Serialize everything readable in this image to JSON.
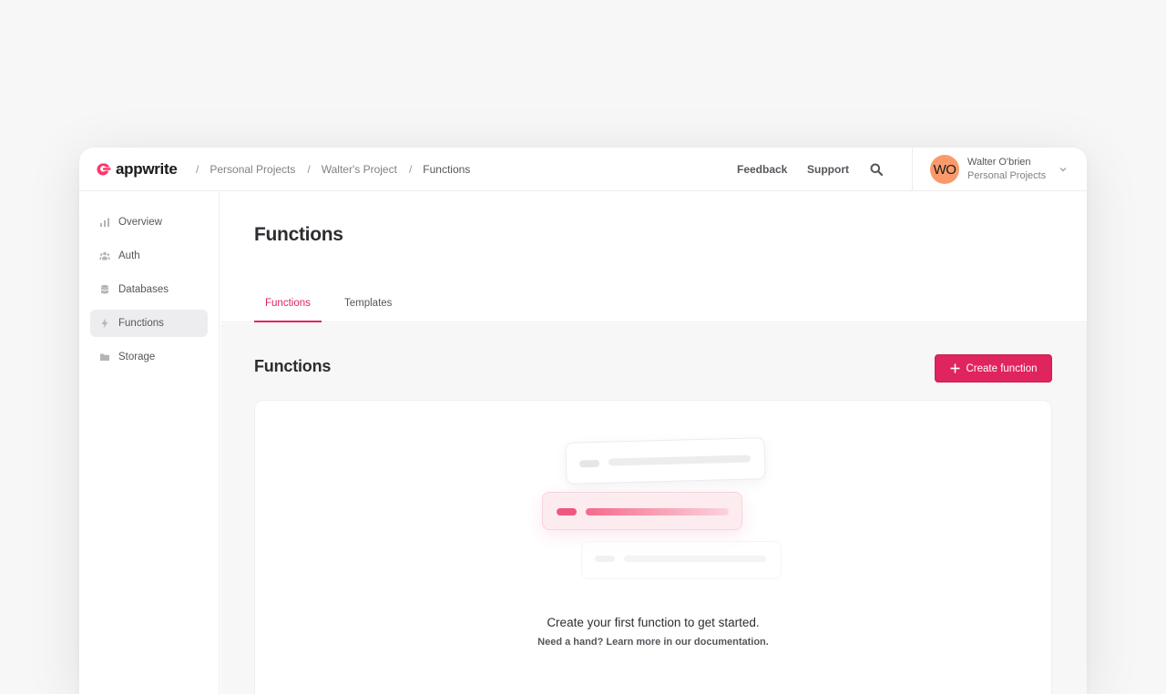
{
  "brand": {
    "name": "appwrite",
    "accent": "#e0245e"
  },
  "breadcrumb": [
    "Personal Projects",
    "Walter's Project",
    "Functions"
  ],
  "header": {
    "feedback": "Feedback",
    "support": "Support",
    "search_icon": "search-icon",
    "user": {
      "initials": "WO",
      "name": "Walter O'brien",
      "org": "Personal Projects"
    }
  },
  "sidebar": {
    "items": [
      {
        "label": "Overview",
        "icon": "bar-chart-icon",
        "active": false
      },
      {
        "label": "Auth",
        "icon": "users-icon",
        "active": false
      },
      {
        "label": "Databases",
        "icon": "database-icon",
        "active": false
      },
      {
        "label": "Functions",
        "icon": "lightning-icon",
        "active": true
      },
      {
        "label": "Storage",
        "icon": "folder-icon",
        "active": false
      }
    ]
  },
  "main": {
    "title": "Functions",
    "tabs": [
      {
        "label": "Functions",
        "active": true
      },
      {
        "label": "Templates",
        "active": false
      }
    ],
    "section_title": "Functions",
    "create_button": "Create function",
    "empty_state": {
      "title": "Create your first function to get started.",
      "subtitle": "Need a hand? Learn more in our documentation."
    }
  }
}
